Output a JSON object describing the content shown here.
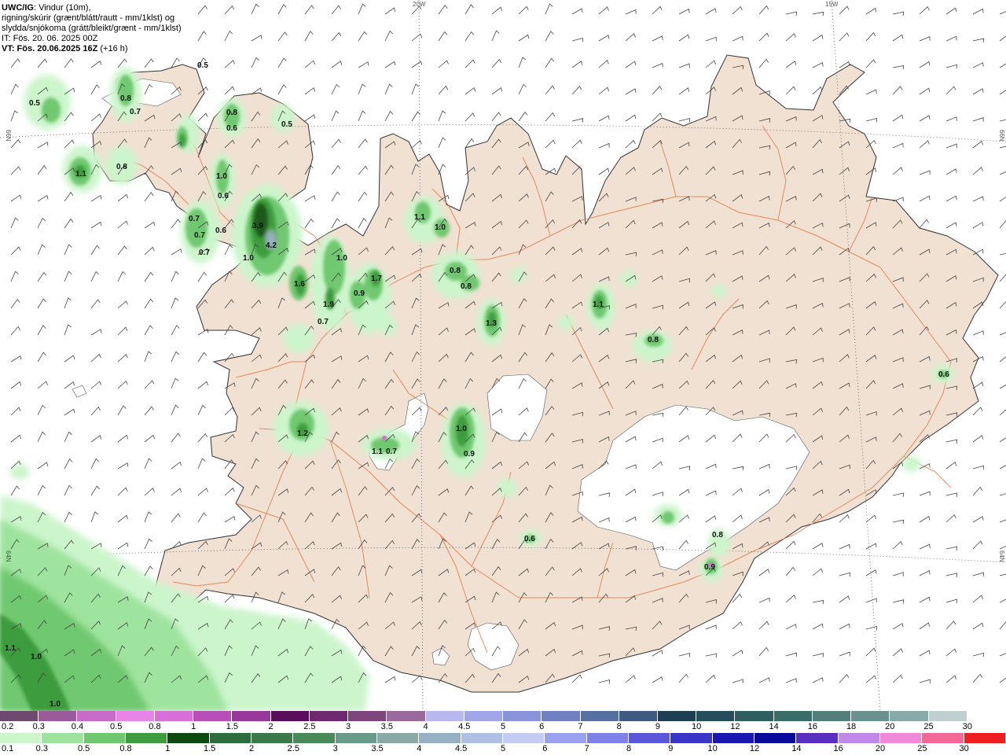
{
  "header": {
    "model": "UWC/IG",
    "line1_rest": ": Vindur (10m),",
    "line2": "rigning/skúrir (grænt/blátt/rautt - mm/1klst) og",
    "line3": "slydda/snjókoma (grátt/bleikt/grænt - mm/1klst)",
    "it_label": "IT: Fös. 20. 06. 2025 00Z",
    "vt_label": "VT: Fös. 20.06.2025 16Z",
    "vt_offset": "(+16 h)"
  },
  "graticule": {
    "lon_20w": "20W",
    "lon_15w": "15W",
    "lat_66n_left": "66N",
    "lat_66n_right": "66N",
    "lat_64n_left": "64N",
    "lat_64n_right": "64N"
  },
  "colors": {
    "land": "#f0e1d2",
    "sea": "#ffffff",
    "road": "#e07a4c",
    "coast": "#333333"
  },
  "precip_labels": [
    {
      "text": "0.5"
    },
    {
      "text": "0.5"
    },
    {
      "text": "0.8"
    },
    {
      "text": "0.7"
    },
    {
      "text": "0.8"
    },
    {
      "text": "0.6"
    },
    {
      "text": "0.5"
    },
    {
      "text": "1.1"
    },
    {
      "text": "0.8"
    },
    {
      "text": "1.0"
    },
    {
      "text": "0.6"
    },
    {
      "text": "0.7"
    },
    {
      "text": "0.7"
    },
    {
      "text": "0.6"
    },
    {
      "text": "3.9"
    },
    {
      "text": "4.2"
    },
    {
      "text": "1.0"
    },
    {
      "text": "1.6"
    },
    {
      "text": "1.0"
    },
    {
      "text": "1.9"
    },
    {
      "text": "0.7"
    },
    {
      "text": "0.9"
    },
    {
      "text": "1.7"
    },
    {
      "text": "1.1"
    },
    {
      "text": "1.0"
    },
    {
      "text": "0.8"
    },
    {
      "text": "0.8"
    },
    {
      "text": "1.3"
    },
    {
      "text": "1.1"
    },
    {
      "text": "0.8"
    },
    {
      "text": "0.6"
    },
    {
      "text": "1.2"
    },
    {
      "text": "1.1"
    },
    {
      "text": "0.7"
    },
    {
      "text": "1.0"
    },
    {
      "text": "0.9"
    },
    {
      "text": "0.6"
    },
    {
      "text": "0.8"
    },
    {
      "text": "0.9"
    },
    {
      "text": "1.1"
    },
    {
      "text": "1.0"
    },
    {
      "text": "1.0"
    },
    {
      "text": "0.7"
    }
  ],
  "legend_snow": {
    "labels": [
      "0.2",
      "0.3",
      "0.4",
      "0.5",
      "0.8",
      "1",
      "1.5",
      "2",
      "2.5",
      "3",
      "3.5",
      "4",
      "4.5",
      "5",
      "6",
      "7",
      "8",
      "9",
      "10",
      "12",
      "14",
      "16",
      "18",
      "20",
      "25",
      "30"
    ],
    "colors": [
      "#6e4b6e",
      "#9b5b9b",
      "#c86bc8",
      "#e884e8",
      "#d870d8",
      "#b84eb8",
      "#98389a",
      "#5a0d5a",
      "#6f2a6f",
      "#7d477d",
      "#9a6a9a",
      "#b8b8ee",
      "#a0a6e8",
      "#8a92d8",
      "#7080c0",
      "#5870a0",
      "#3e5a80",
      "#1e3f52",
      "#264e5a",
      "#2e5e60",
      "#3a6c68",
      "#527e7c",
      "#6a9090",
      "#88aaa8",
      "#c0d0d0",
      "#ffffff"
    ]
  },
  "legend_rain": {
    "labels": [
      "0.1",
      "0.3",
      "0.5",
      "0.8",
      "1",
      "1.5",
      "2",
      "2.5",
      "3",
      "3.5",
      "4",
      "4.5",
      "5",
      "6",
      "7",
      "8",
      "9",
      "10",
      "12",
      "14",
      "16",
      "20",
      "25",
      "30"
    ],
    "colors": [
      "#ccf5cc",
      "#9ee39e",
      "#6fc86f",
      "#3e9c3e",
      "#0e4a0e",
      "#2e6e3e",
      "#3a7a4a",
      "#4a8a5a",
      "#6a9a8a",
      "#8aaaa6",
      "#98b0c4",
      "#b0c0e4",
      "#c4ccf4",
      "#9aa2f0",
      "#7e82e8",
      "#5a58d8",
      "#3a36c8",
      "#1a18b0",
      "#0a0a9a",
      "#5a2ec0",
      "#c088e8",
      "#f08ad8",
      "#f46898",
      "#ec2020"
    ]
  }
}
